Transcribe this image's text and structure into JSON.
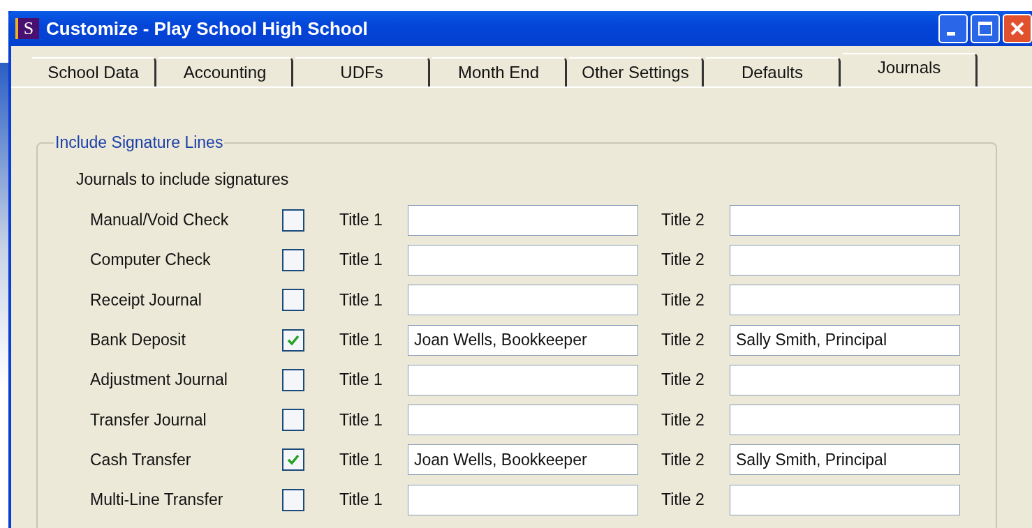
{
  "window": {
    "title": "Customize - Play School High School",
    "app_icon_letter": "S"
  },
  "tabs": [
    {
      "label": "School Data",
      "selected": false
    },
    {
      "label": "Accounting",
      "selected": false
    },
    {
      "label": "UDFs",
      "selected": false
    },
    {
      "label": "Month End",
      "selected": false
    },
    {
      "label": "Other Settings",
      "selected": false
    },
    {
      "label": "Defaults",
      "selected": false
    },
    {
      "label": "Journals",
      "selected": true
    }
  ],
  "group": {
    "legend": "Include Signature Lines",
    "heading": "Journals to include signatures",
    "rows": [
      {
        "name": "Manual/Void Check",
        "checked": false,
        "title1_label": "Title 1",
        "title1": "",
        "title2_label": "Title 2",
        "title2": ""
      },
      {
        "name": "Computer Check",
        "checked": false,
        "title1_label": "Title 1",
        "title1": "",
        "title2_label": "Title 2",
        "title2": ""
      },
      {
        "name": "Receipt Journal",
        "checked": false,
        "title1_label": "Title 1",
        "title1": "",
        "title2_label": "Title 2",
        "title2": ""
      },
      {
        "name": "Bank Deposit",
        "checked": true,
        "title1_label": "Title 1",
        "title1": "Joan Wells, Bookkeeper",
        "title2_label": "Title 2",
        "title2": "Sally Smith, Principal"
      },
      {
        "name": "Adjustment Journal",
        "checked": false,
        "title1_label": "Title 1",
        "title1": "",
        "title2_label": "Title 2",
        "title2": ""
      },
      {
        "name": "Transfer Journal",
        "checked": false,
        "title1_label": "Title 1",
        "title1": "",
        "title2_label": "Title 2",
        "title2": ""
      },
      {
        "name": "Cash Transfer",
        "checked": true,
        "title1_label": "Title 1",
        "title1": "Joan Wells, Bookkeeper",
        "title2_label": "Title 2",
        "title2": "Sally Smith, Principal"
      },
      {
        "name": "Multi-Line Transfer",
        "checked": false,
        "title1_label": "Title 1",
        "title1": "",
        "title2_label": "Title 2",
        "title2": ""
      }
    ]
  }
}
